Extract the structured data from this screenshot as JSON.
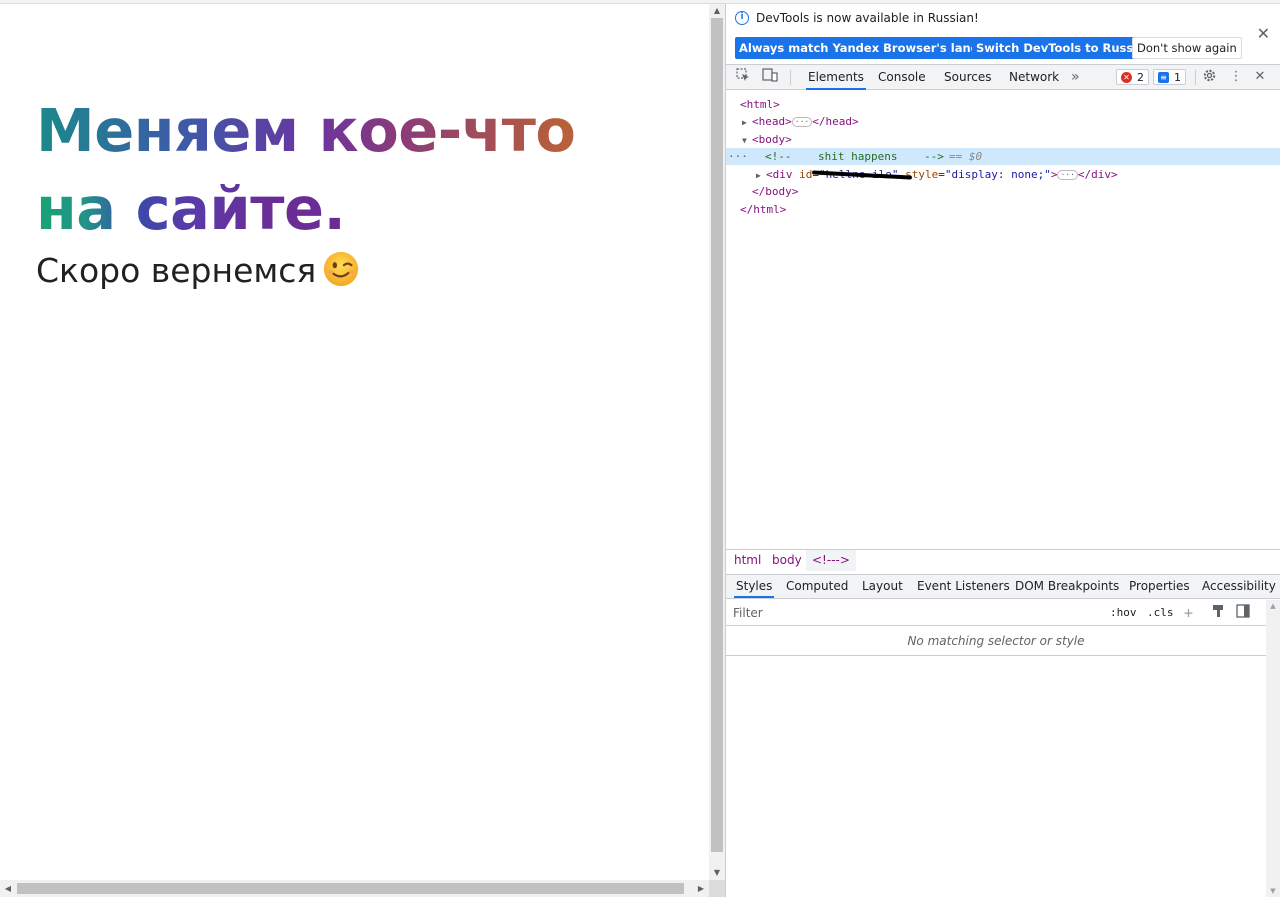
{
  "page": {
    "headline_line1": "Меняем кое-что",
    "headline_line2": "на сайте.",
    "subline": "Скоро вернемся",
    "emoji": "winking-face"
  },
  "devtools": {
    "infobar": {
      "message": "DevTools is now available in Russian!",
      "button_match": "Always match Yandex Browser's language",
      "button_switch": "Switch DevTools to Russian",
      "button_dismiss": "Don't show again",
      "close": "✕"
    },
    "tabs": [
      "Elements",
      "Console",
      "Sources",
      "Network"
    ],
    "more_tabs": "»",
    "error_count": "2",
    "message_count": "1",
    "dom": {
      "html_open": "<html>",
      "head": "<head>",
      "head_close": "</head>",
      "body_open": "<body>",
      "comment_open": "<!--",
      "comment_text": "shit happens",
      "comment_close": "-->",
      "selected_marker": "== $0",
      "div_open": "<div",
      "div_attr_id": "id",
      "div_attr_id_val": "\"hellne-ilo\"",
      "div_attr_style": "style",
      "div_attr_style_val": "\"display: none;\"",
      "div_gt": ">",
      "div_close": "</div>",
      "body_close": "</body>",
      "html_close": "</html>",
      "gutter": "···"
    },
    "breadcrumb": [
      "html",
      "body",
      "<!--->"
    ],
    "subtabs": [
      "Styles",
      "Computed",
      "Layout",
      "Event Listeners",
      "DOM Breakpoints",
      "Properties",
      "Accessibility"
    ],
    "filter_placeholder": "Filter",
    "hov": ":hov",
    "cls": ".cls",
    "no_match": "No matching selector or style"
  }
}
